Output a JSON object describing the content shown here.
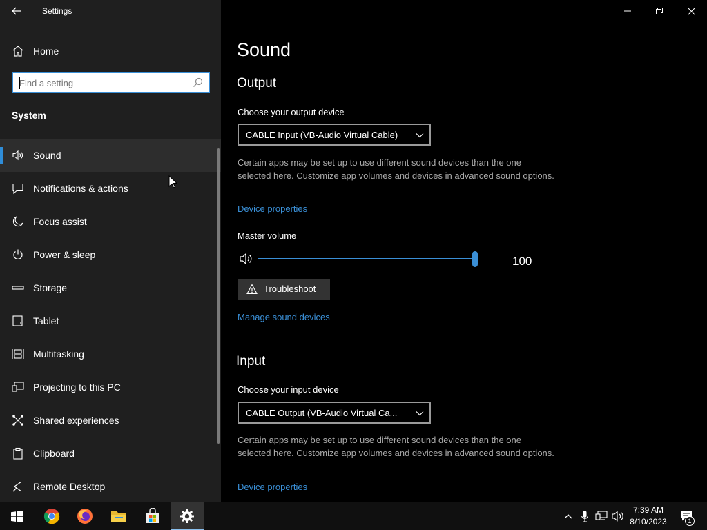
{
  "window": {
    "title": "Settings"
  },
  "sidebar": {
    "home_label": "Home",
    "search_placeholder": "Find a setting",
    "section_title": "System",
    "items": [
      {
        "label": "Sound",
        "icon": "speaker-icon",
        "active": true
      },
      {
        "label": "Notifications & actions",
        "icon": "notification-icon"
      },
      {
        "label": "Focus assist",
        "icon": "moon-icon"
      },
      {
        "label": "Power & sleep",
        "icon": "power-icon"
      },
      {
        "label": "Storage",
        "icon": "storage-icon"
      },
      {
        "label": "Tablet",
        "icon": "tablet-icon"
      },
      {
        "label": "Multitasking",
        "icon": "multitasking-icon"
      },
      {
        "label": "Projecting to this PC",
        "icon": "projecting-icon"
      },
      {
        "label": "Shared experiences",
        "icon": "shared-icon"
      },
      {
        "label": "Clipboard",
        "icon": "clipboard-icon"
      },
      {
        "label": "Remote Desktop",
        "icon": "remote-desktop-icon"
      }
    ]
  },
  "main": {
    "page_title": "Sound",
    "output": {
      "heading": "Output",
      "device_label": "Choose your output device",
      "device_value": "CABLE Input (VB-Audio Virtual Cable)",
      "description": "Certain apps may be set up to use different sound devices than the one selected here. Customize app volumes and devices in advanced sound options.",
      "device_properties_link": "Device properties",
      "master_volume_label": "Master volume",
      "volume_value": "100",
      "volume_fraction": 1.0,
      "troubleshoot_label": "Troubleshoot",
      "manage_link": "Manage sound devices"
    },
    "input": {
      "heading": "Input",
      "device_label": "Choose your input device",
      "device_value": "CABLE Output (VB-Audio Virtual Ca...",
      "description": "Certain apps may be set up to use different sound devices than the one selected here. Customize app volumes and devices in advanced sound options.",
      "device_properties_link": "Device properties"
    }
  },
  "taskbar": {
    "apps": [
      "start-icon",
      "chrome-icon",
      "firefox-icon",
      "file-explorer-icon",
      "store-icon",
      "settings-icon"
    ],
    "time": "7:39 AM",
    "date": "8/10/2023",
    "notification_count": "1"
  },
  "colors": {
    "accent": "#3a8fd6",
    "sidebar_bg": "#1f1f1f",
    "main_bg": "#000000"
  }
}
